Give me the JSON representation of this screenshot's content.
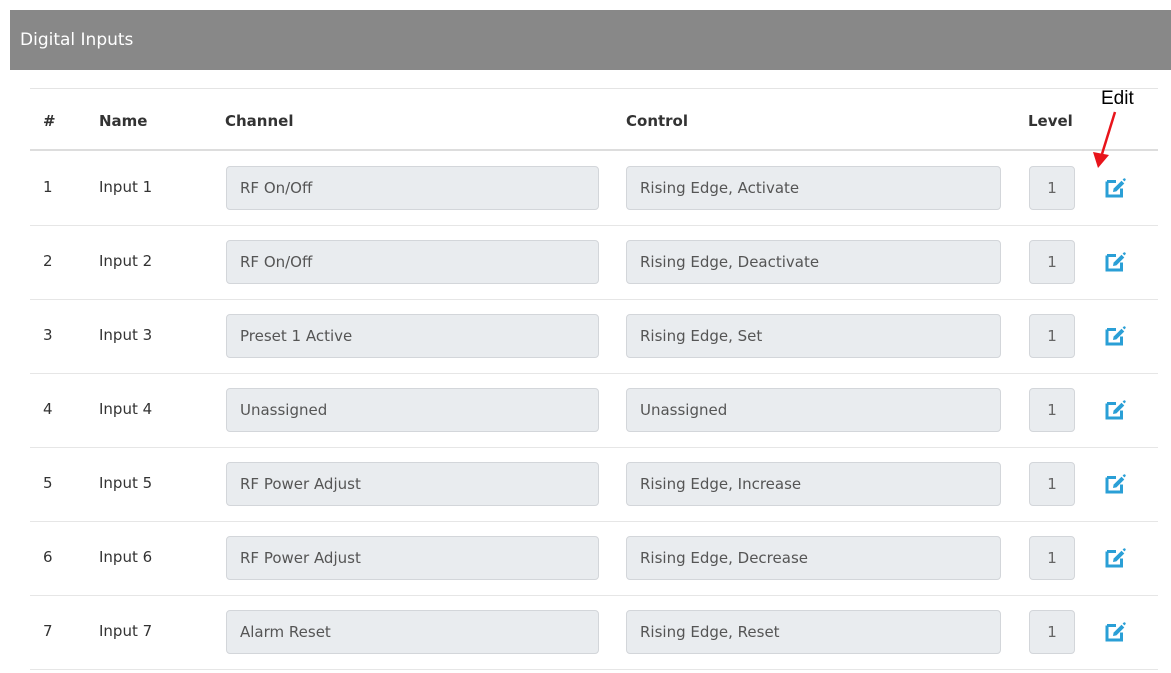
{
  "panel": {
    "title": "Digital Inputs"
  },
  "table": {
    "headers": {
      "num": "#",
      "name": "Name",
      "channel": "Channel",
      "control": "Control",
      "level": "Level"
    },
    "rows": [
      {
        "num": "1",
        "name": "Input 1",
        "channel": "RF On/Off",
        "control": "Rising Edge, Activate",
        "level": "1"
      },
      {
        "num": "2",
        "name": "Input 2",
        "channel": "RF On/Off",
        "control": "Rising Edge, Deactivate",
        "level": "1"
      },
      {
        "num": "3",
        "name": "Input 3",
        "channel": "Preset 1 Active",
        "control": "Rising Edge, Set",
        "level": "1"
      },
      {
        "num": "4",
        "name": "Input 4",
        "channel": "Unassigned",
        "control": "Unassigned",
        "level": "1"
      },
      {
        "num": "5",
        "name": "Input 5",
        "channel": "RF Power Adjust",
        "control": "Rising Edge, Increase",
        "level": "1"
      },
      {
        "num": "6",
        "name": "Input 6",
        "channel": "RF Power Adjust",
        "control": "Rising Edge, Decrease",
        "level": "1"
      },
      {
        "num": "7",
        "name": "Input 7",
        "channel": "Alarm Reset",
        "control": "Rising Edge, Reset",
        "level": "1"
      }
    ]
  },
  "annotation": {
    "label": "Edit",
    "arrow_color": "#e8141b"
  },
  "colors": {
    "header_bg": "#888888",
    "icon": "#2a9fd6",
    "field_bg": "#e9ecef"
  },
  "icons": {
    "edit": "edit-icon"
  }
}
